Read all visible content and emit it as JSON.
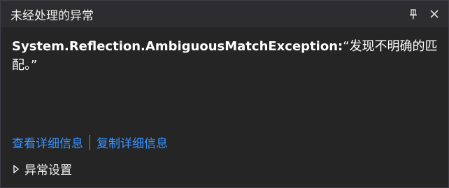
{
  "window": {
    "title": "未经处理的异常"
  },
  "exception": {
    "type": "System.Reflection.AmbiguousMatchException:",
    "message": "“发现不明确的匹配。”"
  },
  "links": {
    "view_details": "查看详细信息",
    "copy_details": "复制详细信息"
  },
  "settings": {
    "label": "异常设置"
  },
  "icons": {
    "pin": "pin-icon",
    "close": "close-icon",
    "expander": "triangle-right-icon"
  },
  "colors": {
    "background": "#252526",
    "titlebar": "#2d2d30",
    "link": "#3794ff",
    "text": "#f1f1f1"
  }
}
